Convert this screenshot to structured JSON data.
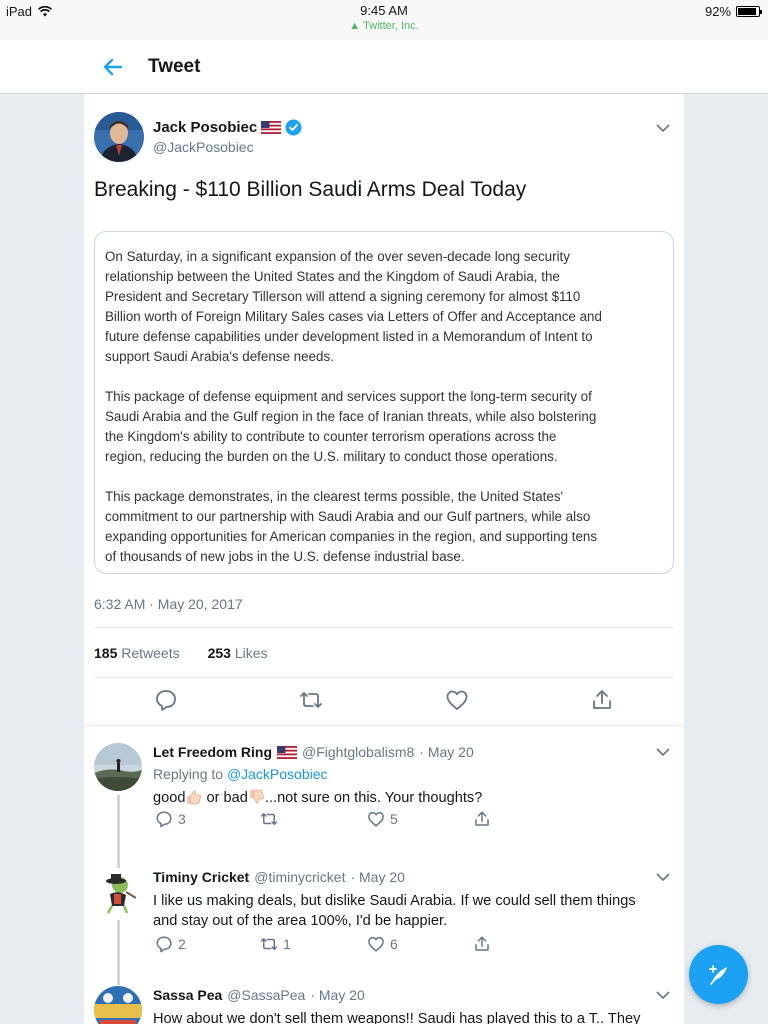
{
  "status_bar": {
    "device": "iPad",
    "time": "9:45 AM",
    "app": "Twitter, Inc.",
    "battery": "92%",
    "battery_level": 0.92
  },
  "nav": {
    "title": "Tweet"
  },
  "main_tweet": {
    "author_name": "Jack Posobiec",
    "handle": "@JackPosobiec",
    "text": "Breaking - $110 Billion Saudi Arms Deal Today",
    "card_paragraphs": [
      [
        "On Saturday, in a significant expansion of the over seven-decade long security",
        "relationship between the United States and the Kingdom of Saudi Arabia, the",
        "President and Secretary Tillerson will attend a signing ceremony for almost $110",
        "Billion worth of Foreign Military Sales cases via Letters of Offer and Acceptance and",
        "future defense capabilities under development listed in a Memorandum of Intent to",
        "support Saudi Arabia's defense needs."
      ],
      [
        "This package of defense equipment and services support the long-term security of",
        "Saudi Arabia and the Gulf region in the face of Iranian threats, while also bolstering",
        "the Kingdom's ability to contribute to counter terrorism operations across the",
        "region, reducing the burden on the U.S. military to conduct those operations."
      ],
      [
        "This package demonstrates, in the clearest terms possible, the United States'",
        "commitment to our partnership with Saudi Arabia and our Gulf partners, while also",
        "expanding opportunities for American companies in the region, and supporting tens",
        "of thousands of new jobs in the U.S. defense industrial base."
      ]
    ],
    "timestamp": "6:32 AM · May 20, 2017",
    "retweets_count": "185",
    "retweets_label": "Retweets",
    "likes_count": "253",
    "likes_label": "Likes"
  },
  "replies": [
    {
      "name": "Let Freedom Ring",
      "handle": "@Fightglobalism8",
      "date": "· May 20",
      "replying_prefix": "Replying to",
      "replying_to": "@JackPosobiec",
      "text_a": "good",
      "text_b": " or bad",
      "text_c": "...not sure on this.  Your thoughts?",
      "reply_count": "3",
      "retweet_count": "",
      "like_count": "5"
    },
    {
      "name": "Timiny Cricket",
      "handle": "@timinycricket",
      "date": "· May 20",
      "text_line1": "I like us making deals, but dislike Saudi Arabia. If we could sell them things",
      "text_line2": "and stay out of the area 100%, I'd be happier.",
      "reply_count": "2",
      "retweet_count": "1",
      "like_count": "6"
    },
    {
      "name": "Sassa Pea",
      "handle": "@SassaPea",
      "date": "· May 20",
      "text_line1": "How about we don't sell them weapons!! Saudi has played this to a T.. They"
    }
  ],
  "colors": {
    "accent": "#1da1f2",
    "link": "#1b95e0",
    "muted": "#657786"
  }
}
